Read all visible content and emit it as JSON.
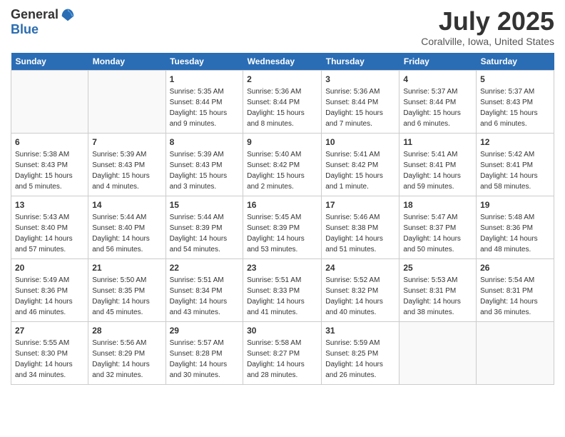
{
  "logo": {
    "general": "General",
    "blue": "Blue"
  },
  "title": "July 2025",
  "location": "Coralville, Iowa, United States",
  "days_of_week": [
    "Sunday",
    "Monday",
    "Tuesday",
    "Wednesday",
    "Thursday",
    "Friday",
    "Saturday"
  ],
  "weeks": [
    [
      {
        "day": "",
        "sunrise": "",
        "sunset": "",
        "daylight": ""
      },
      {
        "day": "",
        "sunrise": "",
        "sunset": "",
        "daylight": ""
      },
      {
        "day": "1",
        "sunrise": "Sunrise: 5:35 AM",
        "sunset": "Sunset: 8:44 PM",
        "daylight": "Daylight: 15 hours and 9 minutes."
      },
      {
        "day": "2",
        "sunrise": "Sunrise: 5:36 AM",
        "sunset": "Sunset: 8:44 PM",
        "daylight": "Daylight: 15 hours and 8 minutes."
      },
      {
        "day": "3",
        "sunrise": "Sunrise: 5:36 AM",
        "sunset": "Sunset: 8:44 PM",
        "daylight": "Daylight: 15 hours and 7 minutes."
      },
      {
        "day": "4",
        "sunrise": "Sunrise: 5:37 AM",
        "sunset": "Sunset: 8:44 PM",
        "daylight": "Daylight: 15 hours and 6 minutes."
      },
      {
        "day": "5",
        "sunrise": "Sunrise: 5:37 AM",
        "sunset": "Sunset: 8:43 PM",
        "daylight": "Daylight: 15 hours and 6 minutes."
      }
    ],
    [
      {
        "day": "6",
        "sunrise": "Sunrise: 5:38 AM",
        "sunset": "Sunset: 8:43 PM",
        "daylight": "Daylight: 15 hours and 5 minutes."
      },
      {
        "day": "7",
        "sunrise": "Sunrise: 5:39 AM",
        "sunset": "Sunset: 8:43 PM",
        "daylight": "Daylight: 15 hours and 4 minutes."
      },
      {
        "day": "8",
        "sunrise": "Sunrise: 5:39 AM",
        "sunset": "Sunset: 8:43 PM",
        "daylight": "Daylight: 15 hours and 3 minutes."
      },
      {
        "day": "9",
        "sunrise": "Sunrise: 5:40 AM",
        "sunset": "Sunset: 8:42 PM",
        "daylight": "Daylight: 15 hours and 2 minutes."
      },
      {
        "day": "10",
        "sunrise": "Sunrise: 5:41 AM",
        "sunset": "Sunset: 8:42 PM",
        "daylight": "Daylight: 15 hours and 1 minute."
      },
      {
        "day": "11",
        "sunrise": "Sunrise: 5:41 AM",
        "sunset": "Sunset: 8:41 PM",
        "daylight": "Daylight: 14 hours and 59 minutes."
      },
      {
        "day": "12",
        "sunrise": "Sunrise: 5:42 AM",
        "sunset": "Sunset: 8:41 PM",
        "daylight": "Daylight: 14 hours and 58 minutes."
      }
    ],
    [
      {
        "day": "13",
        "sunrise": "Sunrise: 5:43 AM",
        "sunset": "Sunset: 8:40 PM",
        "daylight": "Daylight: 14 hours and 57 minutes."
      },
      {
        "day": "14",
        "sunrise": "Sunrise: 5:44 AM",
        "sunset": "Sunset: 8:40 PM",
        "daylight": "Daylight: 14 hours and 56 minutes."
      },
      {
        "day": "15",
        "sunrise": "Sunrise: 5:44 AM",
        "sunset": "Sunset: 8:39 PM",
        "daylight": "Daylight: 14 hours and 54 minutes."
      },
      {
        "day": "16",
        "sunrise": "Sunrise: 5:45 AM",
        "sunset": "Sunset: 8:39 PM",
        "daylight": "Daylight: 14 hours and 53 minutes."
      },
      {
        "day": "17",
        "sunrise": "Sunrise: 5:46 AM",
        "sunset": "Sunset: 8:38 PM",
        "daylight": "Daylight: 14 hours and 51 minutes."
      },
      {
        "day": "18",
        "sunrise": "Sunrise: 5:47 AM",
        "sunset": "Sunset: 8:37 PM",
        "daylight": "Daylight: 14 hours and 50 minutes."
      },
      {
        "day": "19",
        "sunrise": "Sunrise: 5:48 AM",
        "sunset": "Sunset: 8:36 PM",
        "daylight": "Daylight: 14 hours and 48 minutes."
      }
    ],
    [
      {
        "day": "20",
        "sunrise": "Sunrise: 5:49 AM",
        "sunset": "Sunset: 8:36 PM",
        "daylight": "Daylight: 14 hours and 46 minutes."
      },
      {
        "day": "21",
        "sunrise": "Sunrise: 5:50 AM",
        "sunset": "Sunset: 8:35 PM",
        "daylight": "Daylight: 14 hours and 45 minutes."
      },
      {
        "day": "22",
        "sunrise": "Sunrise: 5:51 AM",
        "sunset": "Sunset: 8:34 PM",
        "daylight": "Daylight: 14 hours and 43 minutes."
      },
      {
        "day": "23",
        "sunrise": "Sunrise: 5:51 AM",
        "sunset": "Sunset: 8:33 PM",
        "daylight": "Daylight: 14 hours and 41 minutes."
      },
      {
        "day": "24",
        "sunrise": "Sunrise: 5:52 AM",
        "sunset": "Sunset: 8:32 PM",
        "daylight": "Daylight: 14 hours and 40 minutes."
      },
      {
        "day": "25",
        "sunrise": "Sunrise: 5:53 AM",
        "sunset": "Sunset: 8:31 PM",
        "daylight": "Daylight: 14 hours and 38 minutes."
      },
      {
        "day": "26",
        "sunrise": "Sunrise: 5:54 AM",
        "sunset": "Sunset: 8:31 PM",
        "daylight": "Daylight: 14 hours and 36 minutes."
      }
    ],
    [
      {
        "day": "27",
        "sunrise": "Sunrise: 5:55 AM",
        "sunset": "Sunset: 8:30 PM",
        "daylight": "Daylight: 14 hours and 34 minutes."
      },
      {
        "day": "28",
        "sunrise": "Sunrise: 5:56 AM",
        "sunset": "Sunset: 8:29 PM",
        "daylight": "Daylight: 14 hours and 32 minutes."
      },
      {
        "day": "29",
        "sunrise": "Sunrise: 5:57 AM",
        "sunset": "Sunset: 8:28 PM",
        "daylight": "Daylight: 14 hours and 30 minutes."
      },
      {
        "day": "30",
        "sunrise": "Sunrise: 5:58 AM",
        "sunset": "Sunset: 8:27 PM",
        "daylight": "Daylight: 14 hours and 28 minutes."
      },
      {
        "day": "31",
        "sunrise": "Sunrise: 5:59 AM",
        "sunset": "Sunset: 8:25 PM",
        "daylight": "Daylight: 14 hours and 26 minutes."
      },
      {
        "day": "",
        "sunrise": "",
        "sunset": "",
        "daylight": ""
      },
      {
        "day": "",
        "sunrise": "",
        "sunset": "",
        "daylight": ""
      }
    ]
  ]
}
